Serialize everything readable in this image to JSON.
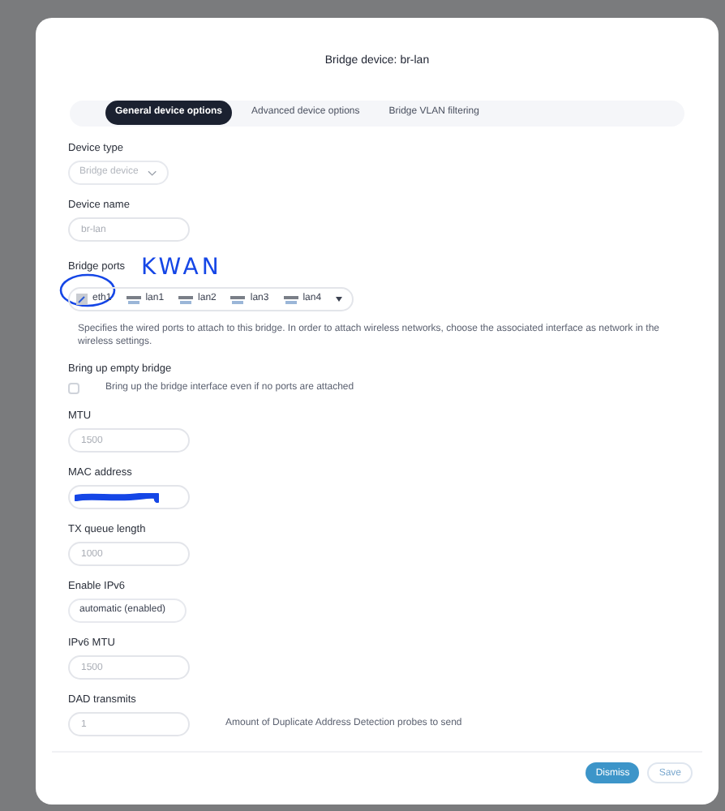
{
  "dialog": {
    "title": "Bridge device: br-lan"
  },
  "tabs": [
    {
      "label": "General device options",
      "selected": true
    },
    {
      "label": "Advanced device options",
      "selected": false
    },
    {
      "label": "Bridge VLAN filtering",
      "selected": false
    }
  ],
  "fields": [
    {
      "kind": "select",
      "label": "Device type",
      "value": "Bridge device",
      "disabled": true
    },
    {
      "kind": "input",
      "label": "Device name",
      "placeholder": "br-lan"
    },
    {
      "kind": "ports",
      "label": "Bridge ports",
      "ports": [
        {
          "name": "eth1",
          "kind": "wan"
        },
        {
          "name": "lan1",
          "kind": "lan"
        },
        {
          "name": "lan2",
          "kind": "lan"
        },
        {
          "name": "lan3",
          "kind": "lan"
        },
        {
          "name": "lan4",
          "kind": "lan"
        }
      ],
      "help": "Specifies the wired ports to attach to this bridge. In order to attach wireless networks, choose the associated interface as network in the wireless settings."
    },
    {
      "kind": "checkbox",
      "label": "Bring up empty bridge",
      "checked": false,
      "help": "Bring up the bridge interface even if no ports are attached"
    },
    {
      "kind": "input",
      "label": "MTU",
      "placeholder": "1500"
    },
    {
      "kind": "redacted",
      "label": "MAC address"
    },
    {
      "kind": "input",
      "label": "TX queue length",
      "placeholder": "1000"
    },
    {
      "kind": "select",
      "label": "Enable IPv6",
      "value": "automatic (enabled)",
      "disabled": false
    },
    {
      "kind": "input",
      "label": "IPv6 MTU",
      "placeholder": "1500"
    },
    {
      "kind": "input",
      "label": "DAD transmits",
      "placeholder": "1",
      "help": "Amount of Duplicate Address Detection probes to send"
    }
  ],
  "annotation": {
    "text": "KWAN"
  },
  "buttons": [
    {
      "label": "Dismiss",
      "kind": "primary"
    },
    {
      "label": "Save",
      "kind": "secondary"
    }
  ]
}
